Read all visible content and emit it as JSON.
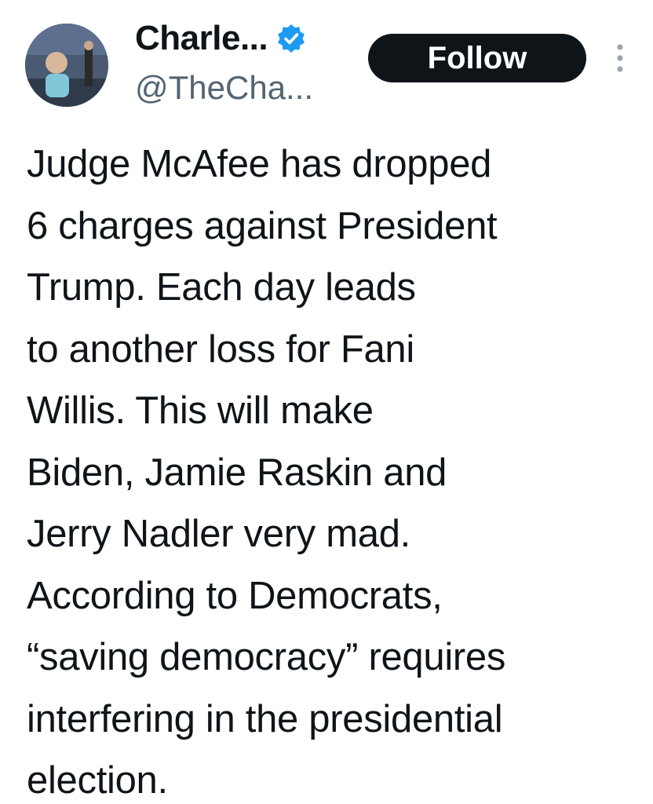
{
  "author": {
    "display_name": "Charle...",
    "handle": "@TheCha...",
    "verified": true,
    "avatar_icon": "avatar-photo",
    "verified_icon": "verified-badge-icon",
    "verified_color": "#1d9bf0"
  },
  "actions": {
    "follow_label": "Follow",
    "more_icon": "more-options-icon"
  },
  "tweet": {
    "lines": [
      "Judge McAfee has dropped",
      "6 charges against President",
      "Trump. Each day leads",
      "to another loss for Fani",
      "Willis. This will make",
      "Biden, Jamie Raskin and",
      "Jerry Nadler very mad.",
      "According to Democrats,",
      "“saving democracy” requires",
      "interfering in the presidential",
      "election."
    ]
  },
  "colors": {
    "text": "#0f1419",
    "secondary_text": "#536471",
    "follow_bg": "#0f1419",
    "follow_text": "#ffffff",
    "background": "#ffffff"
  }
}
